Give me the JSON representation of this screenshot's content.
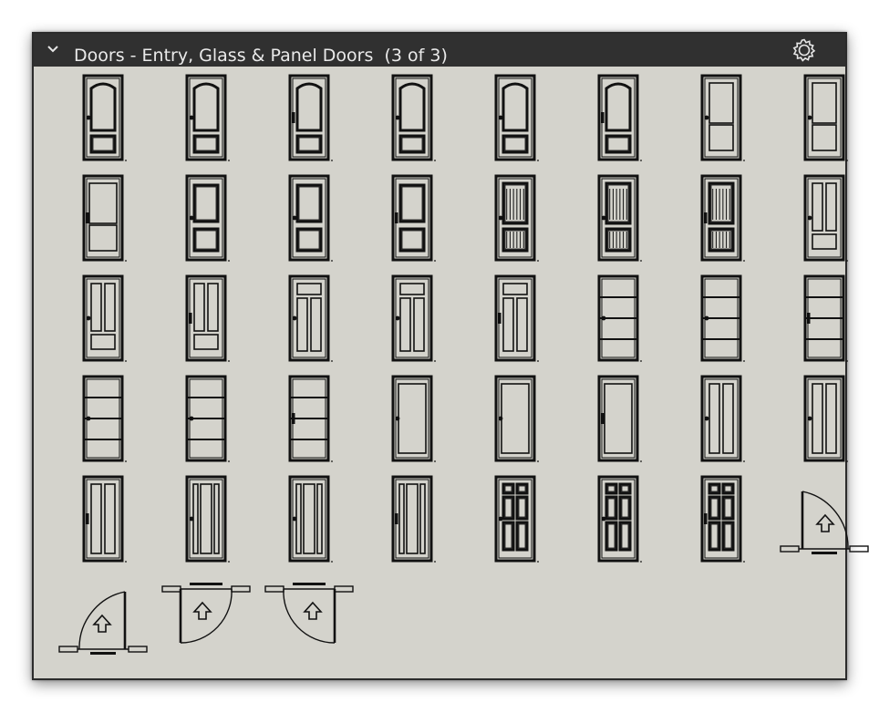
{
  "panel": {
    "title": "Doors - Entry, Glass & Panel Doors  (3 of 3)",
    "icons": {
      "collapse": "chevron-down-icon",
      "settings": "gear-icon"
    }
  },
  "items": [
    {
      "type": "arched",
      "handle": "knob"
    },
    {
      "type": "arched",
      "handle": "knob"
    },
    {
      "type": "arched",
      "handle": "lever"
    },
    {
      "type": "arched",
      "handle": "knob"
    },
    {
      "type": "arched",
      "handle": "knob"
    },
    {
      "type": "arched",
      "handle": "lever"
    },
    {
      "type": "two-panel-plain",
      "handle": "knob"
    },
    {
      "type": "two-panel-plain",
      "handle": "knob"
    },
    {
      "type": "square-glass",
      "handle": "lever"
    },
    {
      "type": "square-glass-panel",
      "handle": "knob"
    },
    {
      "type": "square-glass-panel",
      "handle": "knob"
    },
    {
      "type": "square-glass-panel",
      "handle": "lever"
    },
    {
      "type": "reeded",
      "handle": "knob"
    },
    {
      "type": "reeded",
      "handle": "knob"
    },
    {
      "type": "reeded",
      "handle": "lever"
    },
    {
      "type": "two-tall-bottom",
      "handle": "knob"
    },
    {
      "type": "two-tall-bottom",
      "handle": "knob"
    },
    {
      "type": "two-tall-bottom",
      "handle": "lever"
    },
    {
      "type": "top-transom",
      "handle": "knob"
    },
    {
      "type": "top-transom",
      "handle": "knob"
    },
    {
      "type": "top-transom",
      "handle": "lever"
    },
    {
      "type": "horizontal-rails",
      "handle": "knob"
    },
    {
      "type": "horizontal-rails",
      "handle": "knob"
    },
    {
      "type": "horizontal-rails",
      "handle": "lever"
    },
    {
      "type": "horizontal-rails",
      "handle": "knob"
    },
    {
      "type": "horizontal-rails",
      "handle": "knob"
    },
    {
      "type": "horizontal-rails",
      "handle": "lever"
    },
    {
      "type": "full-glass",
      "handle": "knob"
    },
    {
      "type": "full-glass",
      "handle": "knob"
    },
    {
      "type": "full-glass",
      "handle": "lever"
    },
    {
      "type": "two-tall",
      "handle": "knob"
    },
    {
      "type": "two-tall",
      "handle": "knob"
    },
    {
      "type": "two-tall",
      "handle": "lever"
    },
    {
      "type": "three-vertical",
      "handle": "knob"
    },
    {
      "type": "three-vertical",
      "handle": "knob"
    },
    {
      "type": "three-vertical",
      "handle": "lever"
    },
    {
      "type": "six-panel",
      "handle": "knob"
    },
    {
      "type": "six-panel",
      "handle": "knob"
    },
    {
      "type": "six-panel",
      "handle": "lever"
    },
    {
      "type": "swing-left",
      "handle": "none"
    },
    {
      "type": "swing-right",
      "handle": "none"
    },
    {
      "type": "swing-reverse-left",
      "handle": "none"
    },
    {
      "type": "swing-reverse-right",
      "handle": "none"
    }
  ]
}
